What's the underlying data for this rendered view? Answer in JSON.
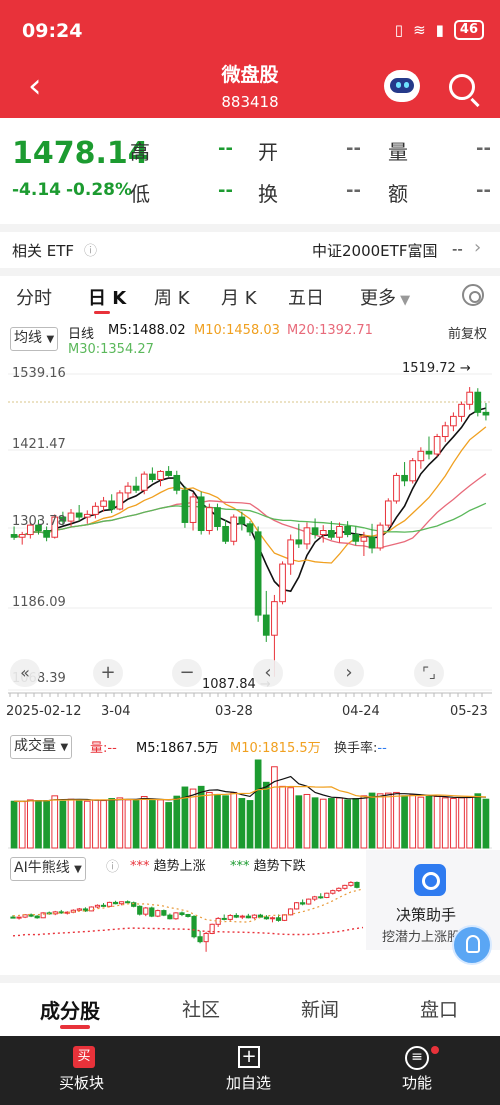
{
  "status_bar": {
    "time": "09:24",
    "battery": "46"
  },
  "header": {
    "title": "微盘股",
    "code": "883418"
  },
  "quote": {
    "price": "1478.14",
    "change": "-4.14",
    "change_pct": "-0.28%",
    "labels": {
      "high": "高",
      "low": "低",
      "open": "开",
      "turnover": "换",
      "volume": "量",
      "amount": "额"
    },
    "placeholder": "--"
  },
  "etf": {
    "label": "相关 ETF",
    "name": "中证2000ETF富国",
    "value": "--"
  },
  "tabs": [
    {
      "label": "分时"
    },
    {
      "label": "日 K"
    },
    {
      "label": "周 K"
    },
    {
      "label": "月 K"
    },
    {
      "label": "五日"
    },
    {
      "label": "更多"
    }
  ],
  "main_chart": {
    "indicator_button": "均线",
    "period_label": "日线",
    "ma5": "M5:1488.02",
    "ma10": "M10:1458.03",
    "ma20": "M20:1392.71",
    "ma30": "M30:1354.27",
    "adjust": "前复权",
    "y_labels": [
      "1539.16",
      "1421.47",
      "1303.78",
      "1186.09",
      "1068.39"
    ],
    "high_annotation": "1519.72",
    "low_annotation": "1087.84",
    "x_labels": [
      "2025-02-12",
      "3-04",
      "03-28",
      "04-24",
      "05-23"
    ]
  },
  "volume_chart": {
    "indicator_button": "成交量",
    "vol_label": "量:--",
    "m5": "M5:1867.5万",
    "m10": "M10:1815.5万",
    "turnover_label": "换手率:",
    "turnover_value": "--"
  },
  "ai_chart": {
    "indicator_button": "AI牛熊线",
    "legend_up": "趋势上涨",
    "legend_down": "趋势下跌"
  },
  "ai_assistant": {
    "title": "决策助手",
    "subtitle": "挖潜力上涨股"
  },
  "sub_tabs": [
    {
      "label": "成分股"
    },
    {
      "label": "社区"
    },
    {
      "label": "新闻"
    },
    {
      "label": "盘口"
    }
  ],
  "bottom_nav": [
    {
      "label": "买板块"
    },
    {
      "label": "加自选"
    },
    {
      "label": "功能"
    }
  ],
  "colors": {
    "up": "#e8323a",
    "down": "#1c9b30",
    "ma5": "#111111",
    "ma10": "#f0a020",
    "ma20": "#e86a7a",
    "ma30": "#5bb85b"
  },
  "chart_data": {
    "type": "candlestick",
    "y_range": [
      1068.39,
      1539.16
    ],
    "ohlc": [
      [
        1300,
        1312,
        1292,
        1296
      ],
      [
        1296,
        1304,
        1285,
        1300
      ],
      [
        1300,
        1318,
        1294,
        1314
      ],
      [
        1314,
        1322,
        1300,
        1306
      ],
      [
        1306,
        1312,
        1290,
        1296
      ],
      [
        1296,
        1330,
        1294,
        1326
      ],
      [
        1326,
        1334,
        1314,
        1320
      ],
      [
        1320,
        1338,
        1312,
        1332
      ],
      [
        1332,
        1344,
        1320,
        1326
      ],
      [
        1326,
        1336,
        1316,
        1330
      ],
      [
        1330,
        1348,
        1324,
        1342
      ],
      [
        1342,
        1356,
        1334,
        1350
      ],
      [
        1350,
        1360,
        1332,
        1338
      ],
      [
        1338,
        1366,
        1336,
        1362
      ],
      [
        1362,
        1378,
        1354,
        1372
      ],
      [
        1372,
        1386,
        1362,
        1366
      ],
      [
        1366,
        1394,
        1360,
        1390
      ],
      [
        1390,
        1400,
        1378,
        1382
      ],
      [
        1382,
        1396,
        1372,
        1394
      ],
      [
        1394,
        1402,
        1386,
        1388
      ],
      [
        1388,
        1395,
        1360,
        1366
      ],
      [
        1366,
        1372,
        1310,
        1318
      ],
      [
        1318,
        1362,
        1306,
        1356
      ],
      [
        1356,
        1364,
        1300,
        1306
      ],
      [
        1306,
        1346,
        1300,
        1340
      ],
      [
        1340,
        1346,
        1306,
        1312
      ],
      [
        1312,
        1322,
        1286,
        1290
      ],
      [
        1290,
        1330,
        1284,
        1326
      ],
      [
        1326,
        1334,
        1306,
        1316
      ],
      [
        1316,
        1320,
        1298,
        1304
      ],
      [
        1304,
        1312,
        1170,
        1180
      ],
      [
        1180,
        1216,
        1140,
        1150
      ],
      [
        1150,
        1210,
        1088,
        1200
      ],
      [
        1200,
        1260,
        1196,
        1256
      ],
      [
        1256,
        1300,
        1240,
        1292
      ],
      [
        1292,
        1316,
        1280,
        1286
      ],
      [
        1286,
        1318,
        1278,
        1310
      ],
      [
        1310,
        1324,
        1294,
        1300
      ],
      [
        1300,
        1314,
        1288,
        1306
      ],
      [
        1306,
        1320,
        1292,
        1296
      ],
      [
        1296,
        1318,
        1288,
        1312
      ],
      [
        1312,
        1320,
        1296,
        1300
      ],
      [
        1300,
        1312,
        1284,
        1290
      ],
      [
        1290,
        1304,
        1268,
        1296
      ],
      [
        1296,
        1316,
        1272,
        1280
      ],
      [
        1280,
        1318,
        1276,
        1314
      ],
      [
        1314,
        1354,
        1310,
        1350
      ],
      [
        1350,
        1392,
        1346,
        1388
      ],
      [
        1388,
        1408,
        1372,
        1380
      ],
      [
        1380,
        1414,
        1376,
        1410
      ],
      [
        1410,
        1430,
        1398,
        1424
      ],
      [
        1424,
        1446,
        1412,
        1420
      ],
      [
        1420,
        1450,
        1416,
        1446
      ],
      [
        1446,
        1468,
        1438,
        1462
      ],
      [
        1462,
        1482,
        1454,
        1476
      ],
      [
        1476,
        1498,
        1468,
        1494
      ],
      [
        1494,
        1519.72,
        1486,
        1512
      ],
      [
        1512,
        1518,
        1476,
        1482
      ],
      [
        1482,
        1496,
        1470,
        1478.14
      ]
    ],
    "volume_m5": "1867.5万",
    "volume_m10": "1815.5万"
  }
}
